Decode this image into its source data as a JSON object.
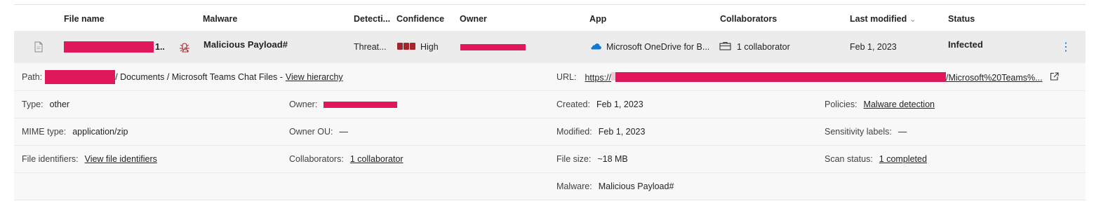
{
  "columns": {
    "file_name": "File name",
    "malware": "Malware",
    "detection": "Detecti...",
    "confidence": "Confidence",
    "owner": "Owner",
    "app": "App",
    "collaborators": "Collaborators",
    "last_modified": "Last modified",
    "status": "Status"
  },
  "row": {
    "file_name_tail": "1..",
    "malware": "Malicious Payload#",
    "detection": "Threat...",
    "confidence": "High",
    "app": "Microsoft OneDrive for B...",
    "collaborators": "1 collaborator",
    "last_modified": "Feb 1, 2023",
    "status": "Infected"
  },
  "details": {
    "path_label": "Path:",
    "path_value": "/ Documents / Microsoft Teams Chat Files -",
    "path_link": "View hierarchy",
    "url_label": "URL:",
    "url_prefix": "https://",
    "url_suffix": "/Microsoft%20Teams%...",
    "type_label": "Type:",
    "type_value": "other",
    "owner_label": "Owner:",
    "created_label": "Created:",
    "created_value": "Feb 1, 2023",
    "policies_label": "Policies:",
    "policies_value": "Malware detection",
    "mime_label": "MIME type:",
    "mime_value": "application/zip",
    "owner_ou_label": "Owner OU:",
    "owner_ou_value": "—",
    "modified_label": "Modified:",
    "modified_value": "Feb 1, 2023",
    "sensitivity_label": "Sensitivity labels:",
    "sensitivity_value": "—",
    "file_id_label": "File identifiers:",
    "file_id_value": "View file identifiers",
    "collab_label": "Collaborators:",
    "collab_value": "1 collaborator",
    "size_label": "File size:",
    "size_value": "~18 MB",
    "scan_label": "Scan status:",
    "scan_value": "1 completed",
    "malware_label": "Malware:",
    "malware_value": "Malicious Payload#"
  },
  "colors": {
    "redaction": "#e0185b",
    "confidence_high": "#a4262c",
    "onedrive": "#0f78d4",
    "accent": "#0f6cbd"
  },
  "icons": [
    "document-icon",
    "malware-bug-icon",
    "onedrive-cloud-icon",
    "collaborator-briefcase-icon",
    "chevron-down-icon",
    "more-options-icon",
    "external-link-icon"
  ]
}
